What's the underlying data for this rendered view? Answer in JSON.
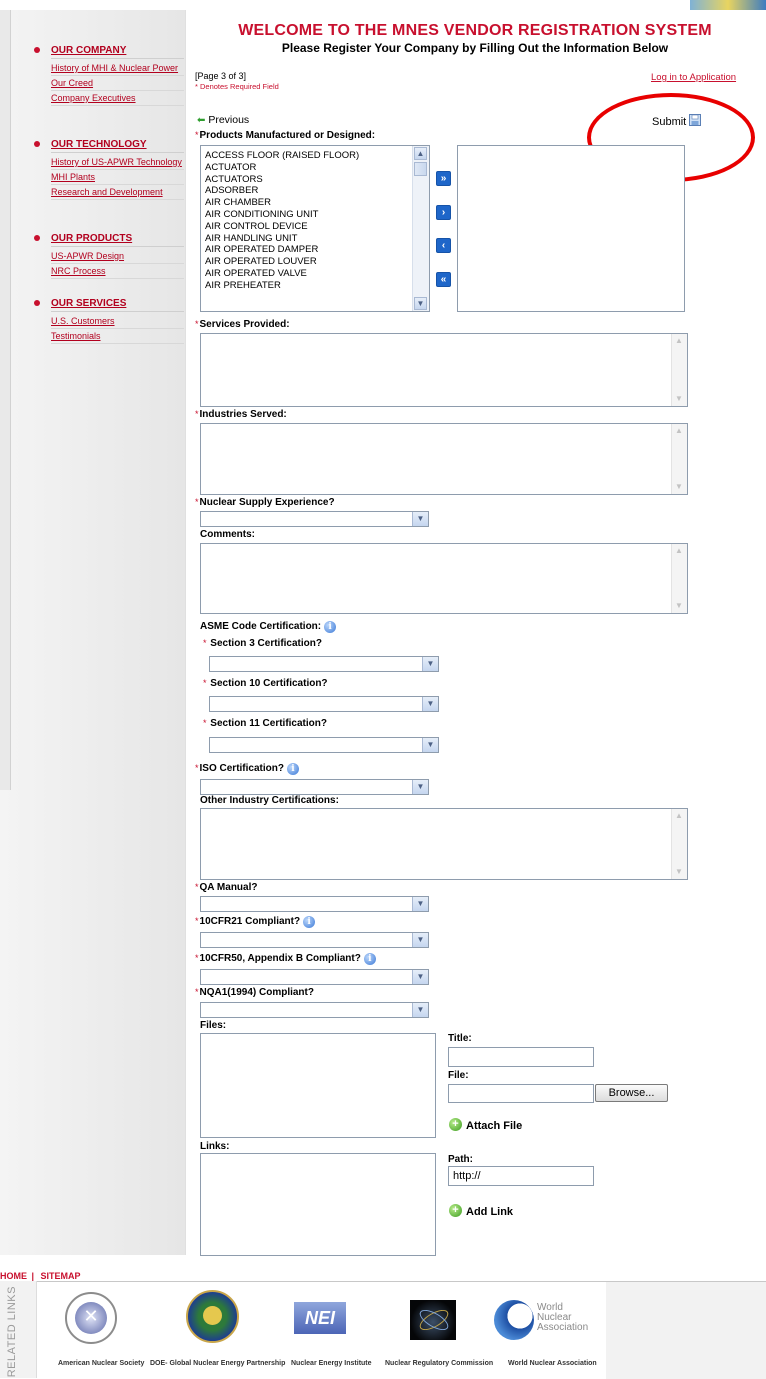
{
  "header": {
    "title": "WELCOME TO THE MNES VENDOR REGISTRATION SYSTEM",
    "subtitle": "Please Register Your Company by Filling Out the Information Below",
    "page_indicator": "[Page 3 of 3]",
    "required_note": "* Denotes Required Field",
    "login_link": "Log in to Application",
    "previous": "Previous",
    "submit": "Submit"
  },
  "sidebar": {
    "sections": [
      {
        "title": "OUR COMPANY",
        "items": [
          "History of MHI & Nuclear Power",
          "Our Creed",
          "Company Executives"
        ]
      },
      {
        "title": "OUR TECHNOLOGY",
        "items": [
          "History of US-APWR Technology",
          "MHI Plants",
          "Research and Development"
        ]
      },
      {
        "title": "OUR PRODUCTS",
        "items": [
          "US-APWR Design",
          "NRC Process"
        ]
      },
      {
        "title": "OUR SERVICES",
        "items": [
          "U.S. Customers",
          "Testimonials"
        ]
      }
    ]
  },
  "form": {
    "products_label": "Products Manufactured or Designed:",
    "products_options": [
      "ACCESS FLOOR (RAISED FLOOR)",
      "ACTUATOR",
      "ACTUATORS",
      "ADSORBER",
      "AIR CHAMBER",
      "AIR CONDITIONING UNIT",
      "AIR CONTROL DEVICE",
      "AIR HANDLING UNIT",
      "AIR OPERATED DAMPER",
      "AIR OPERATED LOUVER",
      "AIR OPERATED VALVE",
      "AIR PREHEATER"
    ],
    "move_buttons": [
      "»",
      "›",
      "‹",
      "«"
    ],
    "services_label": "Services Provided:",
    "industries_label": "Industries Served:",
    "nuclear_label": "Nuclear Supply Experience?",
    "comments_label": "Comments:",
    "asme_label": "ASME Code Certification:",
    "section3_label": "Section 3 Certification?",
    "section10_label": "Section 10 Certification?",
    "section11_label": "Section 11 Certification?",
    "iso_label": "ISO Certification?",
    "other_cert_label": "Other Industry Certifications:",
    "qa_label": "QA Manual?",
    "cfr21_label": "10CFR21 Compliant?",
    "cfr50_label": "10CFR50, Appendix B Compliant?",
    "nqa_label": "NQA1(1994) Compliant?",
    "files_label": "Files:",
    "title_label": "Title:",
    "file_label": "File:",
    "browse_button": "Browse...",
    "attach_file": "Attach File",
    "links_label": "Links:",
    "path_label": "Path:",
    "path_value": "http://",
    "add_link": "Add Link"
  },
  "footer": {
    "nav": [
      "HOME",
      "SITEMAP"
    ],
    "related_links": "RELATED LINKS",
    "logos": [
      "American Nuclear Society",
      "DOE- Global Nuclear Energy Partnership",
      "Nuclear Energy Institute",
      "Nuclear Regulatory Commission",
      "World Nuclear Association"
    ],
    "nei_text": "NEI",
    "wna_text": [
      "World",
      "Nuclear",
      "Association"
    ]
  }
}
